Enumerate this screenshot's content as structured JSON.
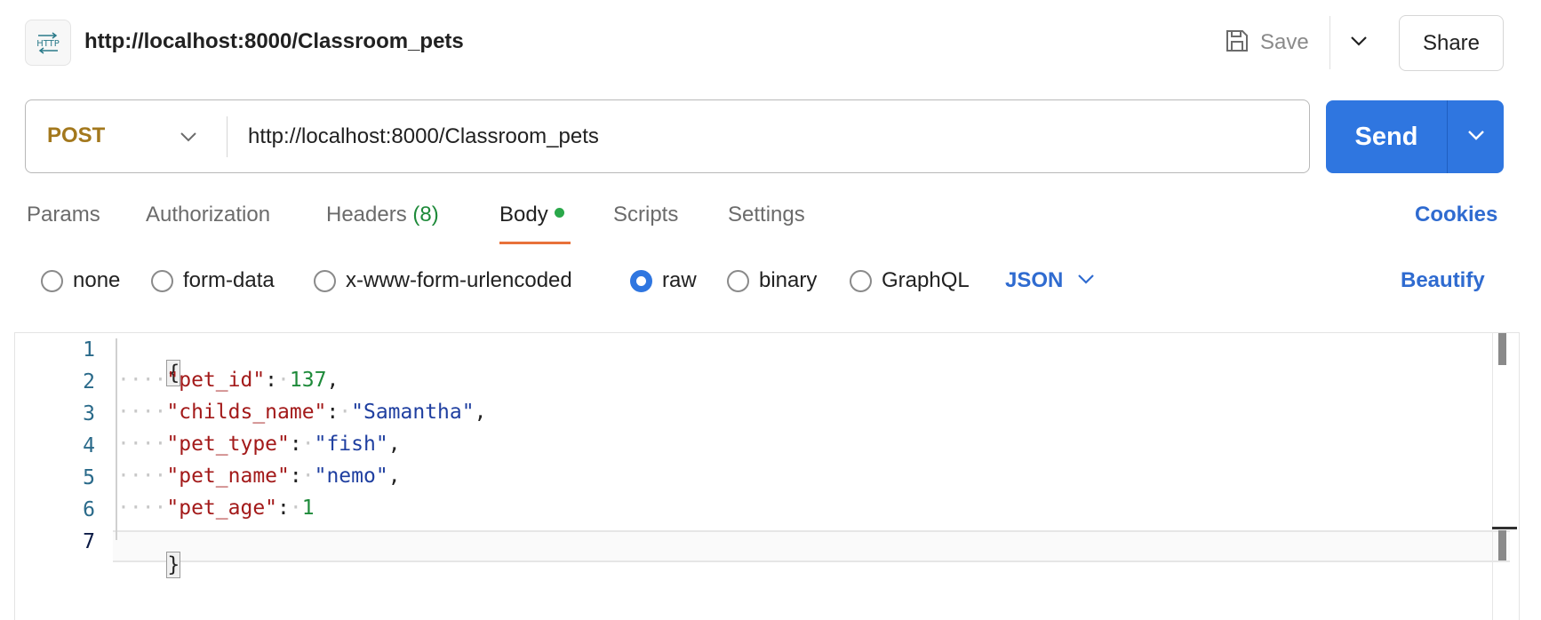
{
  "request": {
    "title": "http://localhost:8000/Classroom_pets",
    "method": "POST",
    "url": "http://localhost:8000/Classroom_pets"
  },
  "toolbar": {
    "save_label": "Save",
    "share_label": "Share",
    "send_label": "Send"
  },
  "tabs": [
    {
      "label": "Params"
    },
    {
      "label": "Authorization"
    },
    {
      "label": "Headers",
      "count": "(8)"
    },
    {
      "label": "Body",
      "active": true
    },
    {
      "label": "Scripts"
    },
    {
      "label": "Settings"
    }
  ],
  "cookies_label": "Cookies",
  "body_types": [
    {
      "label": "none",
      "checked": false
    },
    {
      "label": "form-data",
      "checked": false
    },
    {
      "label": "x-www-form-urlencoded",
      "checked": false
    },
    {
      "label": "raw",
      "checked": true
    },
    {
      "label": "binary",
      "checked": false
    },
    {
      "label": "GraphQL",
      "checked": false
    }
  ],
  "language": "JSON",
  "beautify_label": "Beautify",
  "editor": {
    "line_numbers": [
      "1",
      "2",
      "3",
      "4",
      "5",
      "6",
      "7"
    ],
    "open_brace": "{",
    "close_brace": "}",
    "fields": [
      {
        "key": "\"pet_id\"",
        "value": "137",
        "type": "num",
        "trailing": ","
      },
      {
        "key": "\"childs_name\"",
        "value": "\"Samantha\"",
        "type": "str",
        "trailing": ","
      },
      {
        "key": "\"pet_type\"",
        "value": "\"fish\"",
        "type": "str",
        "trailing": ","
      },
      {
        "key": "\"pet_name\"",
        "value": "\"nemo\"",
        "type": "str",
        "trailing": ","
      },
      {
        "key": "\"pet_age\"",
        "value": "1",
        "type": "num",
        "trailing": ""
      }
    ]
  },
  "colors": {
    "method": "#a3781d",
    "send": "#2f76e0",
    "link": "#2f6bd0",
    "tab_underline": "#e8713a",
    "body_dot": "#2aa84a"
  },
  "icons": {
    "http_badge": "http-icon",
    "save": "floppy-disk-icon",
    "caret": "chevron-down-icon"
  }
}
